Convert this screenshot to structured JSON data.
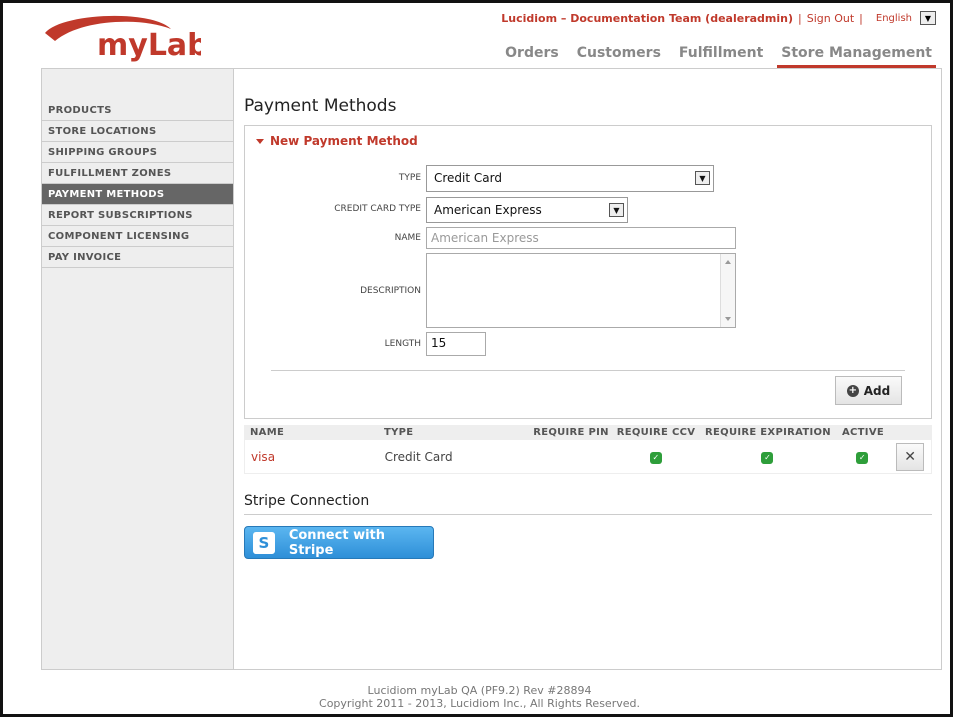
{
  "brand": {
    "logo_text": "myLab"
  },
  "userbar": {
    "team": "Lucidiom – Documentation Team (dealeradmin)",
    "sep1": "|",
    "signout": "Sign Out",
    "sep2": "|",
    "language": "English"
  },
  "nav": {
    "items": [
      "Orders",
      "Customers",
      "Fulfillment",
      "Store Management"
    ],
    "active": "Store Management"
  },
  "sidebar": {
    "items": [
      "PRODUCTS",
      "STORE LOCATIONS",
      "SHIPPING GROUPS",
      "FULFILLMENT ZONES",
      "PAYMENT METHODS",
      "REPORT SUBSCRIPTIONS",
      "COMPONENT LICENSING",
      "PAY INVOICE"
    ],
    "active": "PAYMENT METHODS"
  },
  "page": {
    "title": "Payment Methods"
  },
  "form": {
    "header": "New Payment Method",
    "type_label": "TYPE",
    "type_value": "Credit Card",
    "cc_type_label": "CREDIT CARD TYPE",
    "cc_type_value": "American Express",
    "name_label": "NAME",
    "name_placeholder": "American Express",
    "description_label": "DESCRIPTION",
    "length_label": "LENGTH",
    "length_value": "15",
    "add_label": "Add"
  },
  "table": {
    "headers": [
      "NAME",
      "TYPE",
      "REQUIRE PIN",
      "REQUIRE CCV",
      "REQUIRE EXPIRATION",
      "ACTIVE"
    ],
    "rows": [
      {
        "name": "visa",
        "type": "Credit Card",
        "require_pin": false,
        "require_ccv": true,
        "require_expiration": true,
        "active": true
      }
    ]
  },
  "stripe": {
    "title": "Stripe Connection",
    "button_label": "Connect with Stripe",
    "button_glyph": "S"
  },
  "footer": {
    "line1": "Lucidiom myLab QA (PF9.2) Rev #28894",
    "line2": "Copyright 2011 - 2013, Lucidiom Inc., All Rights Reserved."
  },
  "colors": {
    "accent": "#c0392b",
    "check": "#2e9e3a",
    "stripe": "#2e8fd8"
  }
}
